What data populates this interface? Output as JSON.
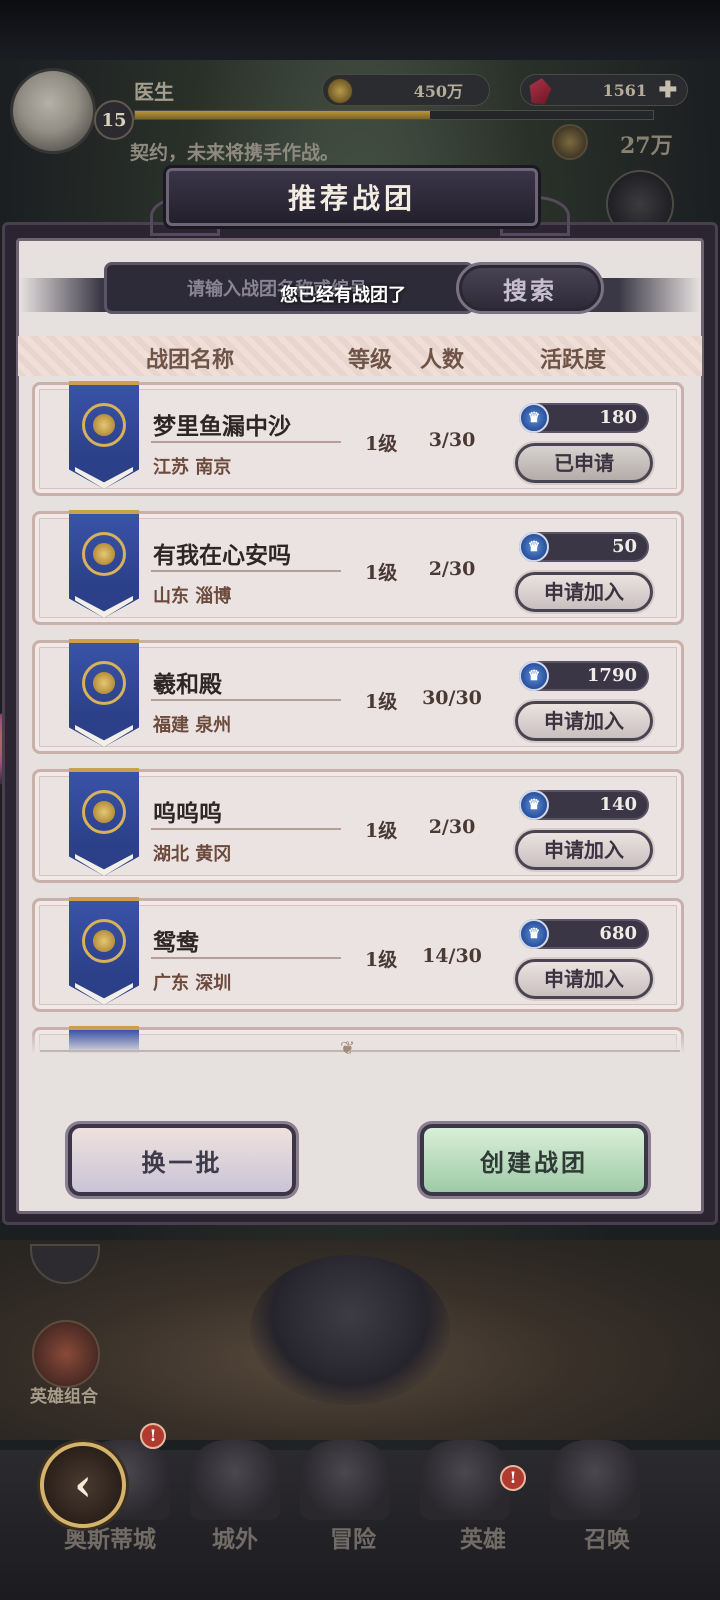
{
  "player": {
    "name": "医生",
    "level": "15",
    "exp_fraction": 0.57,
    "gold": "450万",
    "gems": "1561",
    "motto": "契约，未来将携手作战。",
    "power": "27万"
  },
  "dialog": {
    "title": "推荐战团",
    "search_placeholder": "请输入战团名称或编号",
    "search_button": "搜索",
    "toast": "您已经有战团了"
  },
  "columns": {
    "name": "战团名称",
    "level": "等级",
    "members": "人数",
    "activity": "活跃度"
  },
  "guilds": [
    {
      "name": "梦里鱼漏中沙",
      "location": "江苏 南京",
      "level": "1级",
      "members": "3/30",
      "activity": "180",
      "action": "已申请",
      "applied": true
    },
    {
      "name": "有我在心安吗",
      "location": "山东 淄博",
      "level": "1级",
      "members": "2/30",
      "activity": "50",
      "action": "申请加入",
      "applied": false
    },
    {
      "name": "羲和殿",
      "location": "福建 泉州",
      "level": "1级",
      "members": "30/30",
      "activity": "1790",
      "action": "申请加入",
      "applied": false
    },
    {
      "name": "呜呜呜",
      "location": "湖北 黄冈",
      "level": "1级",
      "members": "2/30",
      "activity": "140",
      "action": "申请加入",
      "applied": false
    },
    {
      "name": "鸳鸯",
      "location": "广东 深圳",
      "level": "1级",
      "members": "14/30",
      "activity": "680",
      "action": "申请加入",
      "applied": false
    }
  ],
  "buttons": {
    "refresh": "换一批",
    "create": "创建战团"
  },
  "side": {
    "hero_combo": "英雄组合"
  },
  "nav": {
    "items": [
      "奥斯蒂城",
      "城外",
      "冒险",
      "英雄",
      "召唤"
    ],
    "alert": "!"
  },
  "colors": {
    "dialog_bg": "#e6e1df",
    "banner_blue": "#2c4089",
    "create_green": "#9fcaa7",
    "activity_crown": "#2a4f9c"
  },
  "icons": [
    "coin-icon",
    "gem-icon",
    "plus-icon",
    "power-icon",
    "crown-icon",
    "banner-emblem-icon",
    "back-arrow-icon",
    "alert-icon"
  ]
}
